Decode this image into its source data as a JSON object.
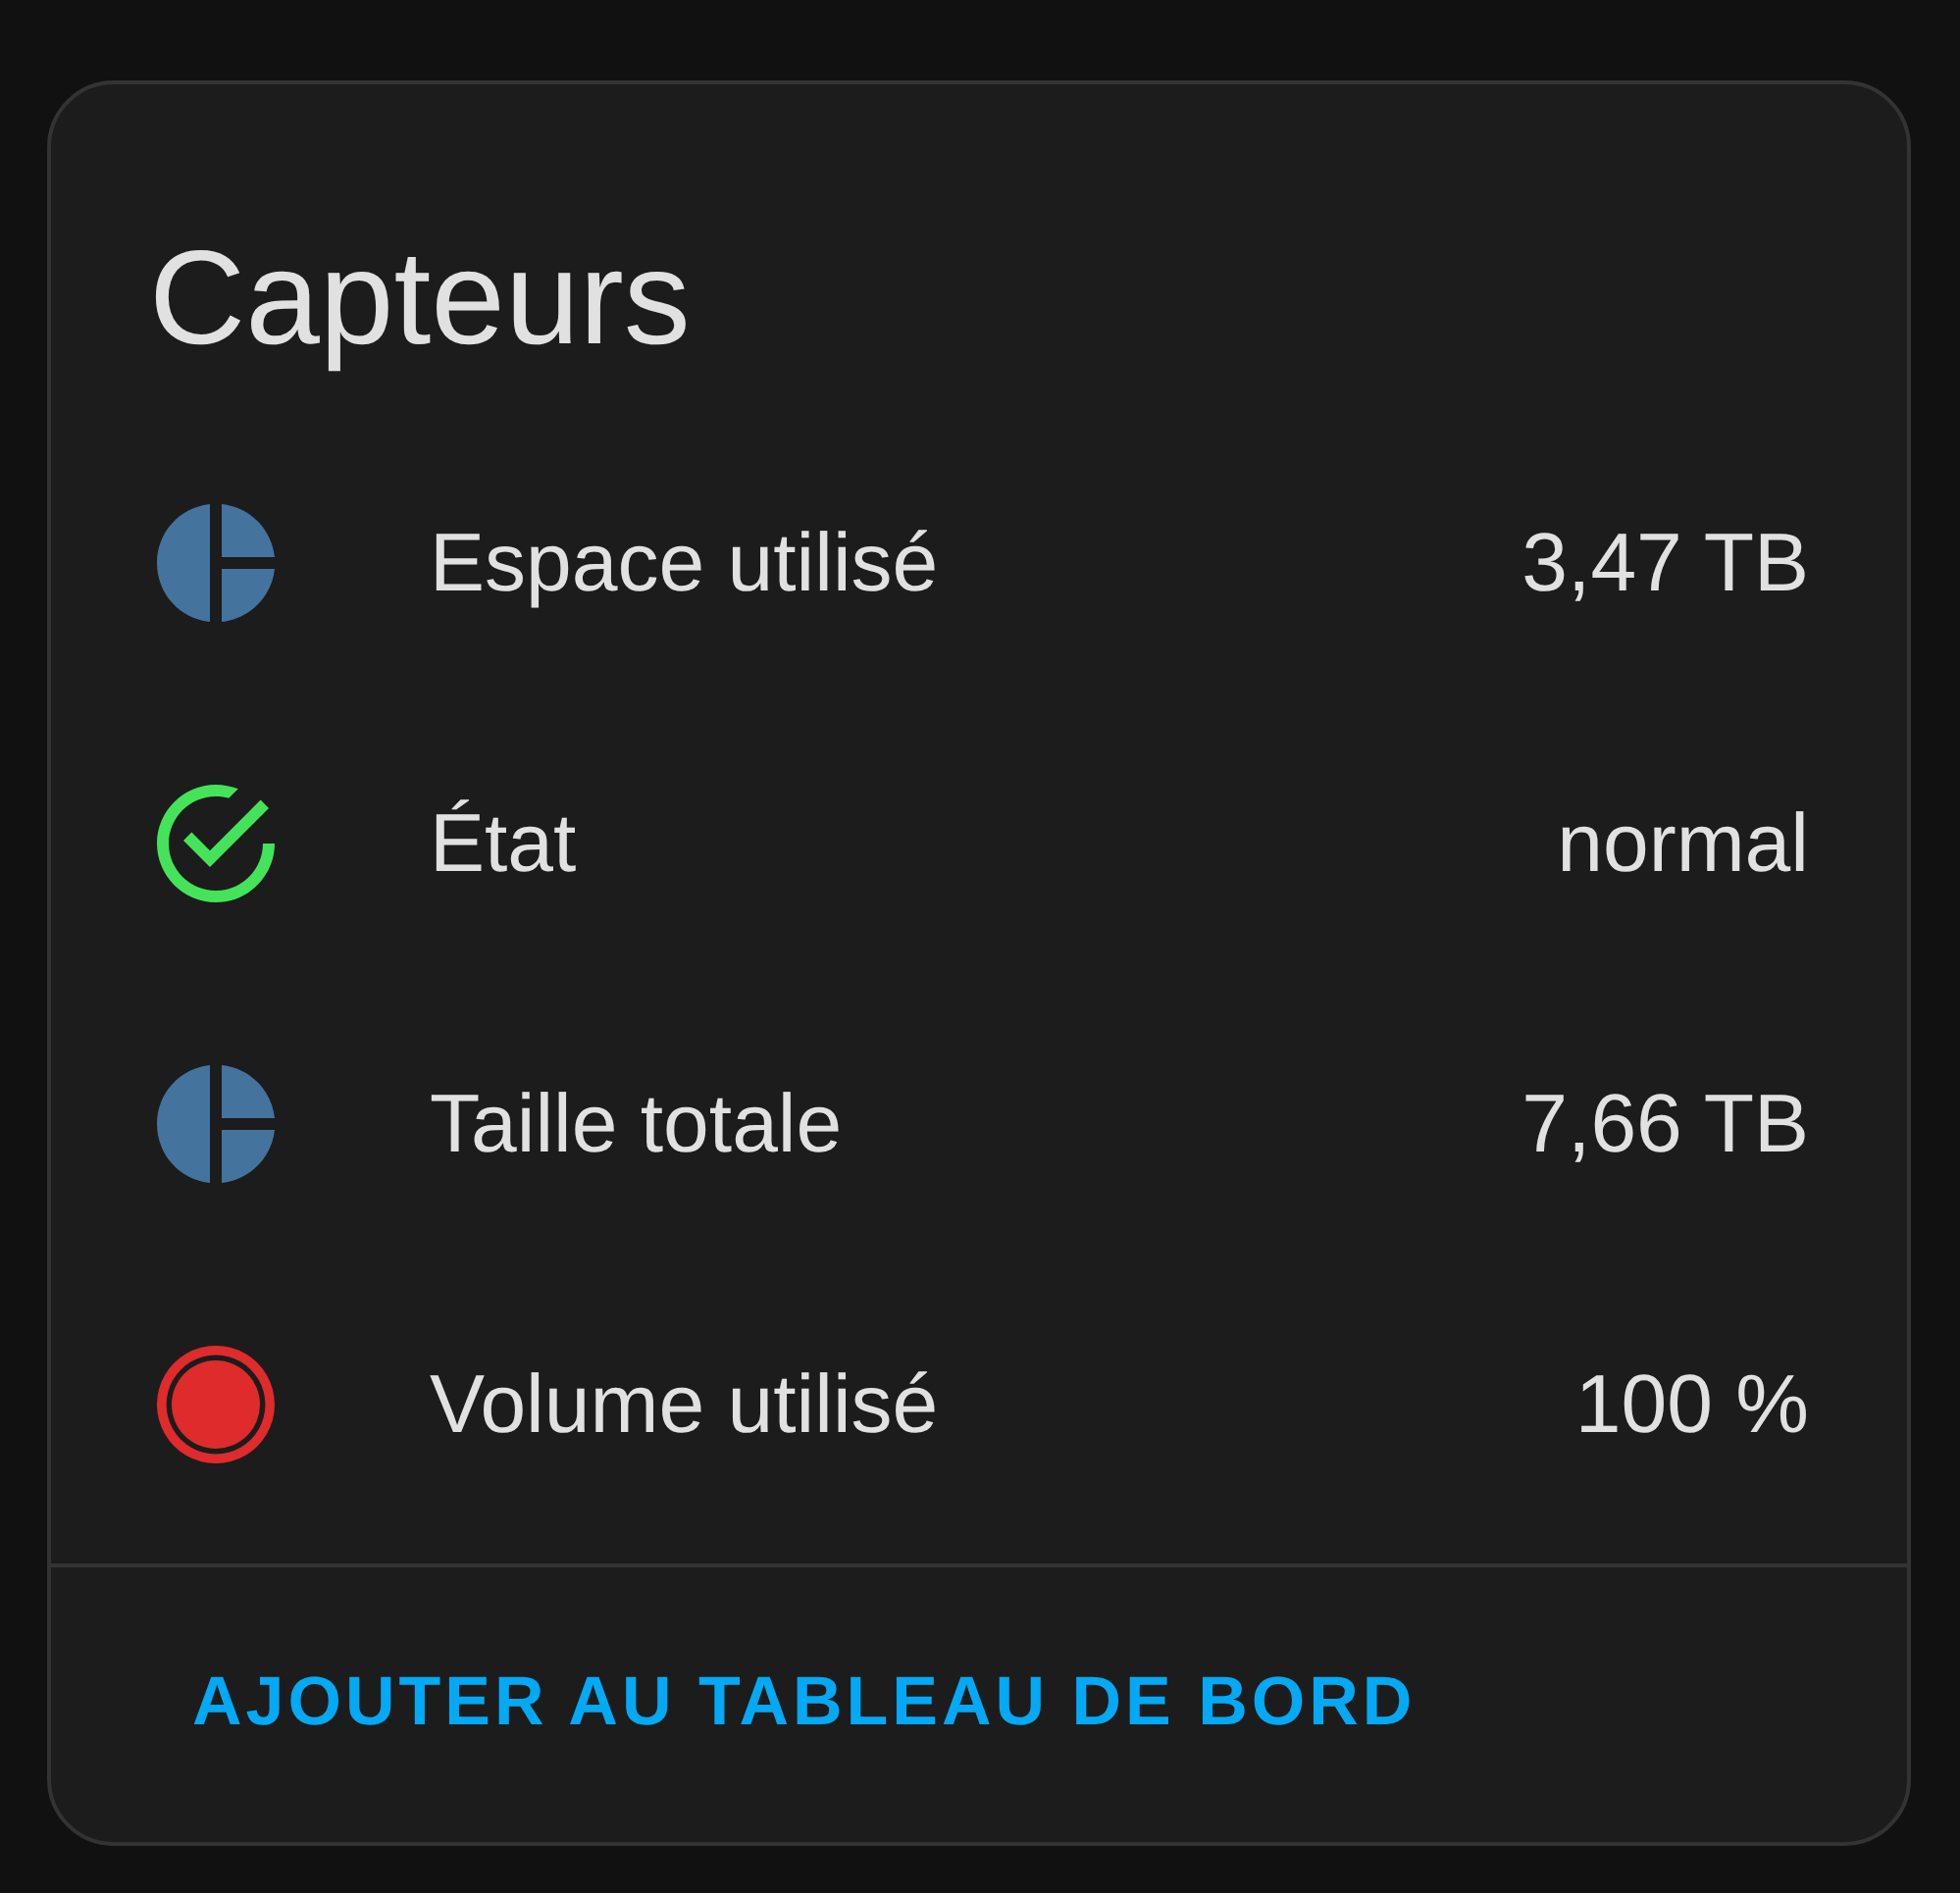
{
  "card": {
    "title": "Capteurs"
  },
  "sensors": [
    {
      "kind": "pie",
      "color": "#44739e",
      "name": "Espace utilisé",
      "value": "3,47 TB"
    },
    {
      "kind": "check",
      "color": "#44e35a",
      "name": "État",
      "value": "normal"
    },
    {
      "kind": "pie",
      "color": "#44739e",
      "name": "Taille totale",
      "value": "7,66 TB"
    },
    {
      "kind": "record",
      "color": "#df2b2b",
      "name": "Volume utilisé",
      "value": "100 %"
    }
  ],
  "action": {
    "label": "AJOUTER AU TABLEAU DE BORD"
  }
}
